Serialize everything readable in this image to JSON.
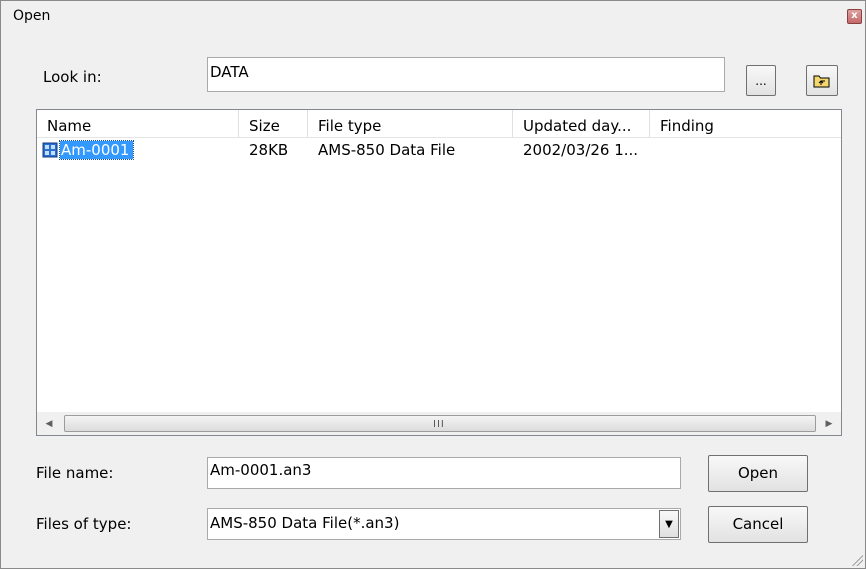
{
  "window": {
    "title": "Open",
    "close_glyph": "x"
  },
  "look_in": {
    "label": "Look in:",
    "value": "DATA",
    "browse_label": "...",
    "up_folder_icon": "folder-up-icon"
  },
  "list": {
    "columns": [
      "Name",
      "Size",
      "File type",
      "Updated day...",
      "Finding"
    ],
    "rows": [
      {
        "name": "Am-0001",
        "size": "28KB",
        "type": "AMS-850 Data File",
        "updated": "2002/03/26 1...",
        "finding": "",
        "icon": "data-file-icon",
        "selected": true
      }
    ],
    "scroll_grip": "III"
  },
  "file_name": {
    "label": "File name:",
    "value": "Am-0001.an3"
  },
  "file_type": {
    "label": "Files of type:",
    "value": "AMS-850 Data File(*.an3)"
  },
  "buttons": {
    "open": "Open",
    "cancel": "Cancel"
  },
  "colors": {
    "selection": "#3399ff",
    "window_bg": "#f0f0f0"
  }
}
